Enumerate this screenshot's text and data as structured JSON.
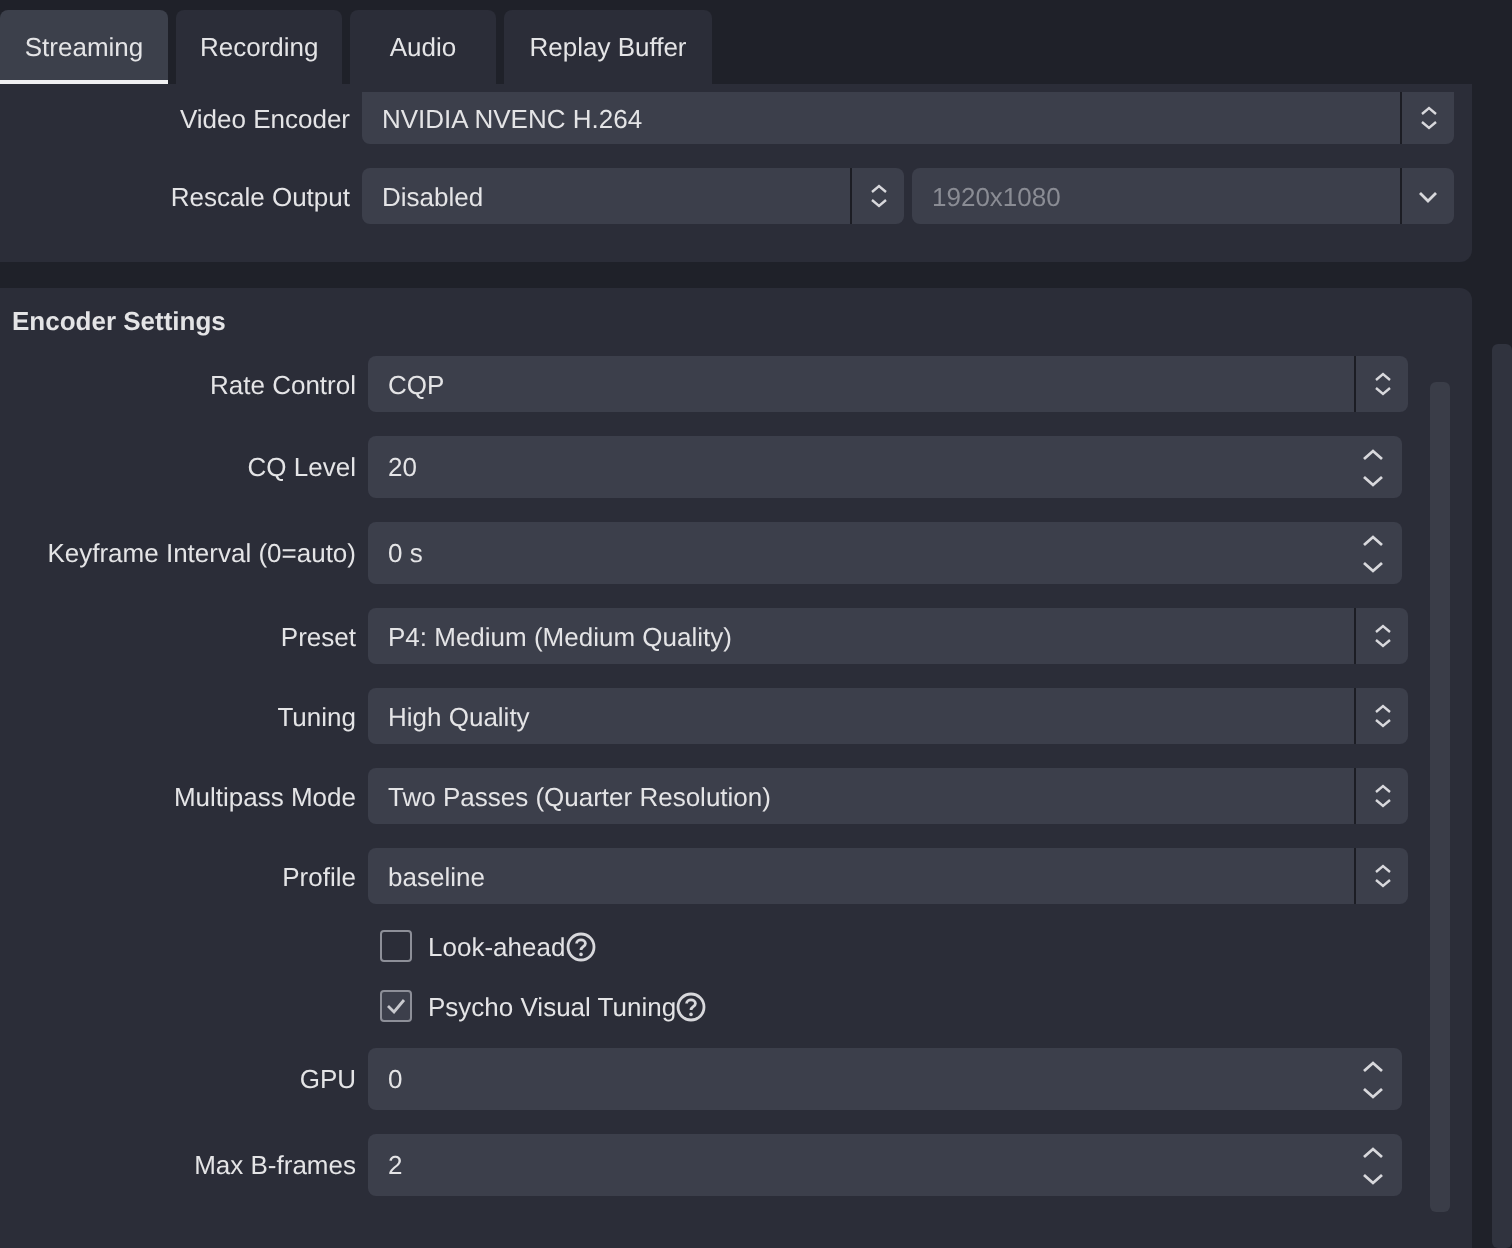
{
  "tabs": [
    {
      "label": "Streaming",
      "selected": true
    },
    {
      "label": "Recording",
      "selected": false
    },
    {
      "label": "Audio",
      "selected": false
    },
    {
      "label": "Replay Buffer",
      "selected": false
    }
  ],
  "output_panel": {
    "rows": [
      {
        "label": "Video Encoder",
        "fields": [
          {
            "kind": "combo",
            "value": "NVIDIA NVENC H.264",
            "disabled": false
          }
        ]
      },
      {
        "label": "Rescale Output",
        "fields": [
          {
            "kind": "combo",
            "value": "Disabled",
            "disabled": false
          },
          {
            "kind": "dropdown",
            "value": "1920x1080",
            "disabled": true
          }
        ]
      }
    ]
  },
  "encoder_settings": {
    "title": "Encoder Settings",
    "rows": [
      {
        "kind": "combo",
        "label": "Rate Control",
        "value": "CQP"
      },
      {
        "kind": "spin",
        "label": "CQ Level",
        "value": "20"
      },
      {
        "kind": "spin",
        "label": "Keyframe Interval (0=auto)",
        "value": "0 s"
      },
      {
        "kind": "combo",
        "label": "Preset",
        "value": "P4: Medium (Medium Quality)"
      },
      {
        "kind": "combo",
        "label": "Tuning",
        "value": "High Quality"
      },
      {
        "kind": "combo",
        "label": "Multipass Mode",
        "value": "Two Passes (Quarter Resolution)"
      },
      {
        "kind": "combo",
        "label": "Profile",
        "value": "baseline"
      },
      {
        "kind": "checkbox",
        "label": "Look-ahead",
        "checked": false
      },
      {
        "kind": "checkbox",
        "label": "Psycho Visual Tuning",
        "checked": true
      },
      {
        "kind": "spin",
        "label": "GPU",
        "value": "0"
      },
      {
        "kind": "spin",
        "label": "Max B-frames",
        "value": "2"
      }
    ]
  }
}
